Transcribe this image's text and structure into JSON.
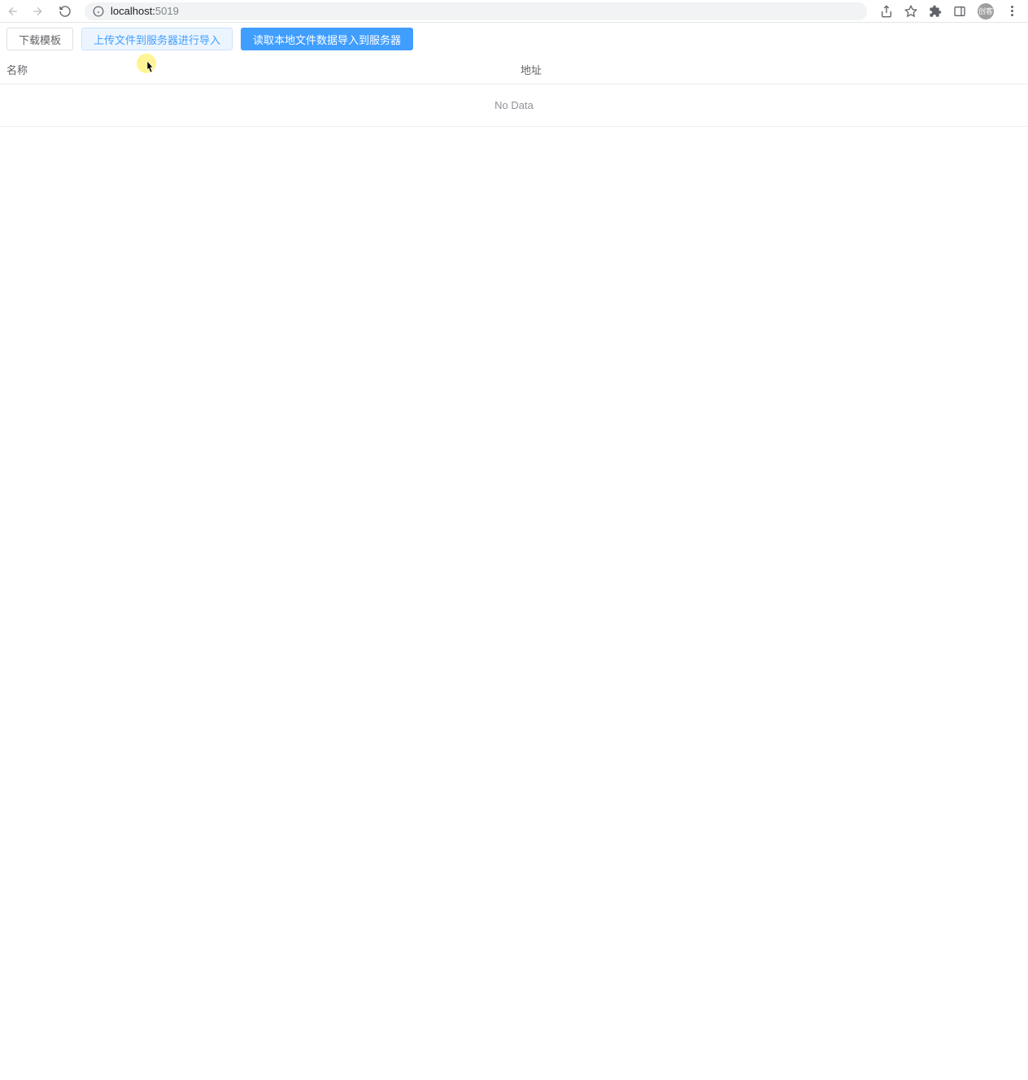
{
  "browser": {
    "url_host": "localhost:",
    "url_port": "5019",
    "avatar_text": "创客"
  },
  "toolbar": {
    "download_template_label": "下载模板",
    "upload_to_server_label": "上传文件到服务器进行导入",
    "read_local_import_label": "读取本地文件数据导入到服务器"
  },
  "table": {
    "columns": {
      "name": "名称",
      "address": "地址"
    },
    "empty_text": "No Data"
  }
}
